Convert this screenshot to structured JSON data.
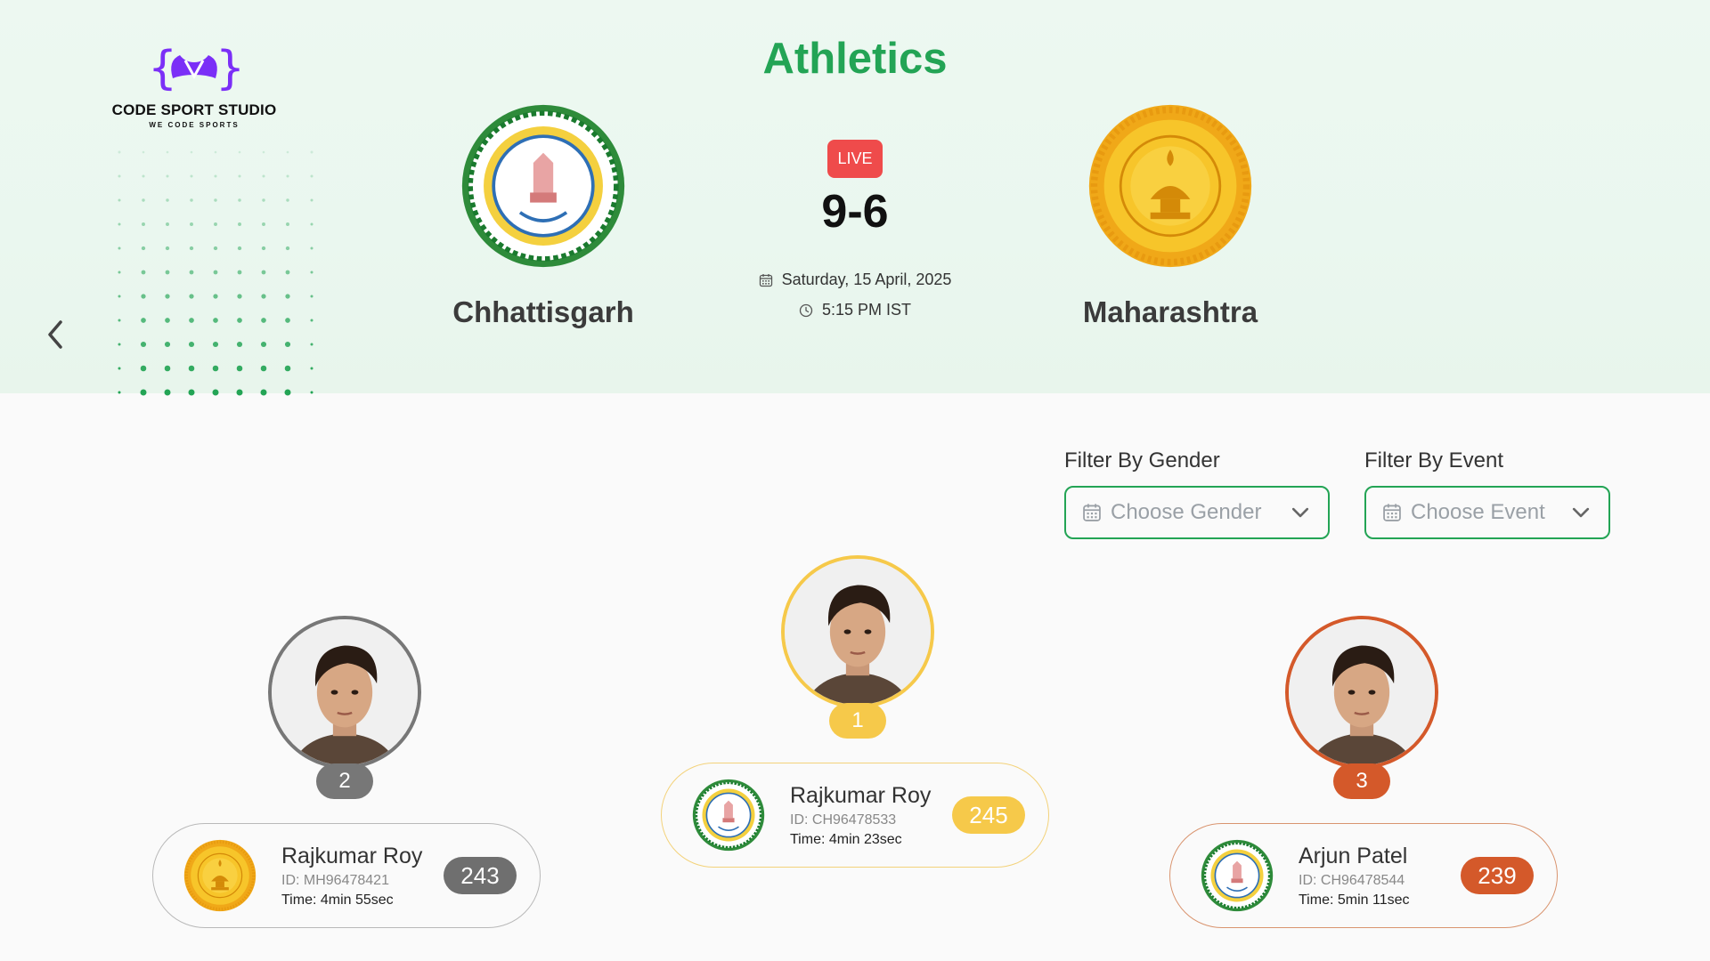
{
  "brand": {
    "name": "CODE SPORT STUDIO",
    "tagline": "WE CODE SPORTS",
    "primary_color": "#23a455",
    "logo_color": "#7b2ff7"
  },
  "event": {
    "title": "Athletics"
  },
  "match": {
    "status": "LIVE",
    "score": "9-6",
    "date": "Saturday, 15 April, 2025",
    "time": "5:15 PM IST",
    "home_team": {
      "name": "Chhattisgarh",
      "emblem": "chhattisgarh-emblem"
    },
    "away_team": {
      "name": "Maharashtra",
      "emblem": "maharashtra-emblem"
    }
  },
  "filters": {
    "gender": {
      "label": "Filter By Gender",
      "placeholder": "Choose Gender",
      "icon": "calendar-icon"
    },
    "event": {
      "label": "Filter By Event",
      "placeholder": "Choose Event",
      "icon": "calendar-icon"
    }
  },
  "podium": [
    {
      "rank": "1",
      "name": "Rajkumar Roy",
      "id": "ID: CH96478533",
      "time": "Time: 4min 23sec",
      "score": "245",
      "team_logo": "chhattisgarh-emblem",
      "color": "#f6c94a"
    },
    {
      "rank": "2",
      "name": "Rajkumar Roy",
      "id": "ID: MH96478421",
      "time": "Time: 4min 55sec",
      "score": "243",
      "team_logo": "maharashtra-emblem",
      "color": "#777777"
    },
    {
      "rank": "3",
      "name": "Arjun Patel",
      "id": "ID: CH96478544",
      "time": "Time: 5min 11sec",
      "score": "239",
      "team_logo": "chhattisgarh-emblem",
      "color": "#d4592a"
    }
  ]
}
